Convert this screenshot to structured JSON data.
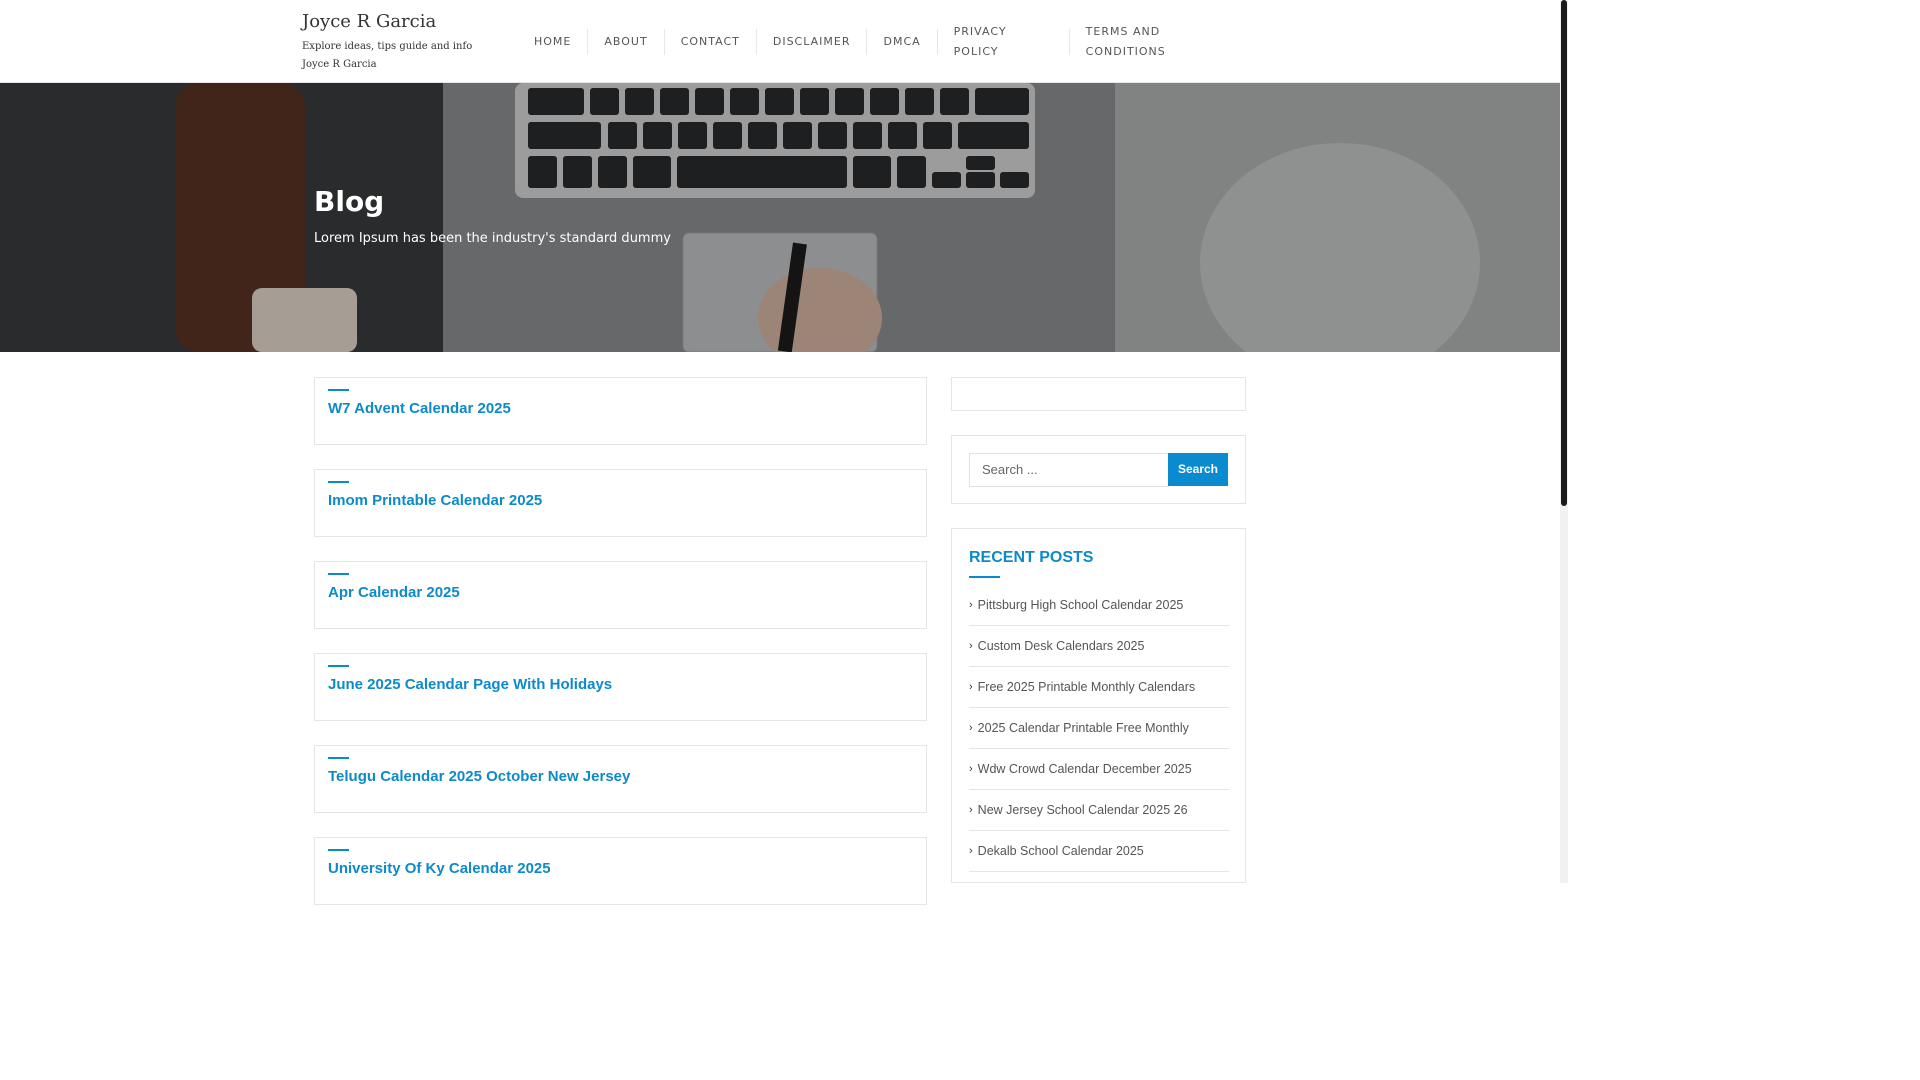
{
  "site": {
    "title": "Joyce R Garcia",
    "description": "Explore ideas, tips guide and info Joyce R Garcia"
  },
  "nav": {
    "items": [
      {
        "label": "HOME"
      },
      {
        "label": "ABOUT"
      },
      {
        "label": "CONTACT"
      },
      {
        "label": "DISCLAIMER"
      },
      {
        "label": "DMCA"
      },
      {
        "label": "PRIVACY POLICY"
      },
      {
        "label": "TERMS AND CONDITIONS"
      }
    ]
  },
  "hero": {
    "title": "Blog",
    "subtitle": "Lorem Ipsum has been the industry's standard dummy"
  },
  "posts": [
    {
      "title": "W7 Advent Calendar 2025"
    },
    {
      "title": "Imom Printable Calendar 2025"
    },
    {
      "title": "Apr Calendar 2025"
    },
    {
      "title": "June 2025 Calendar Page With Holidays"
    },
    {
      "title": "Telugu Calendar 2025 October New Jersey"
    },
    {
      "title": "University Of Ky Calendar 2025"
    }
  ],
  "sidebar": {
    "search": {
      "placeholder": "Search ...",
      "button_label": "Search"
    },
    "recent_posts": {
      "heading": "RECENT POSTS",
      "items": [
        {
          "label": "Pittsburg High School Calendar 2025"
        },
        {
          "label": "Custom Desk Calendars 2025"
        },
        {
          "label": "Free 2025 Printable Monthly Calendars"
        },
        {
          "label": "2025 Calendar Printable Free Monthly"
        },
        {
          "label": "Wdw Crowd Calendar December 2025"
        },
        {
          "label": "New Jersey School Calendar 2025 26"
        },
        {
          "label": "Dekalb School Calendar 2025"
        }
      ]
    }
  },
  "colors": {
    "accent": "#0a8bd0",
    "link": "#0d8ac9"
  }
}
